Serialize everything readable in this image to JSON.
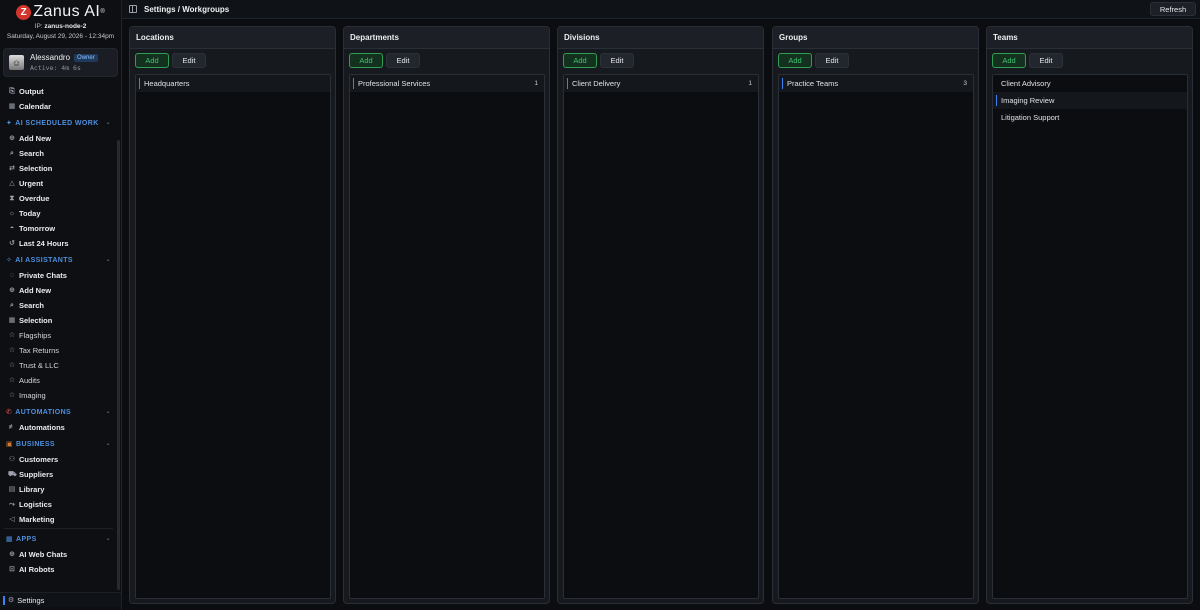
{
  "brand": {
    "logo_letter": "Z",
    "name": "Zanus AI",
    "reg": "®"
  },
  "node": {
    "label": "IP:",
    "value": "zanus-node-2"
  },
  "datetime": "Saturday, August 29, 2026 - 12:34pm",
  "user": {
    "name": "Alessandro",
    "role": "Owner",
    "active": "Active: 4m 6s"
  },
  "nav": {
    "output": "Output",
    "calendar": "Calendar",
    "scheduled": {
      "title": "AI SCHEDULED WORK",
      "items": [
        "Add New",
        "Search",
        "Selection",
        "Urgent",
        "Overdue",
        "Today",
        "Tomorrow",
        "Last 24 Hours"
      ]
    },
    "assistants": {
      "title": "AI ASSISTANTS",
      "items": [
        "Private Chats",
        "Add New",
        "Search",
        "Selection"
      ],
      "sub_items": [
        "Flagships",
        "Tax Returns",
        "Trust & LLC",
        "Audits",
        "Imaging"
      ]
    },
    "automations": {
      "title": "AUTOMATIONS",
      "items": [
        "Automations"
      ]
    },
    "business": {
      "title": "BUSINESS",
      "items": [
        "Customers",
        "Suppliers",
        "Library",
        "Logistics",
        "Marketing"
      ]
    },
    "apps": {
      "title": "APPS",
      "items": [
        "AI Web Chats",
        "AI Robots"
      ]
    },
    "settings": "Settings"
  },
  "topbar": {
    "breadcrumb": "Settings / Workgroups",
    "refresh": "Refresh"
  },
  "buttons": {
    "add": "Add",
    "edit": "Edit"
  },
  "columns": [
    {
      "title": "Locations",
      "rows": [
        {
          "label": "Headquarters",
          "count": ""
        }
      ]
    },
    {
      "title": "Departments",
      "rows": [
        {
          "label": "Professional Services",
          "count": "1"
        }
      ]
    },
    {
      "title": "Divisions",
      "rows": [
        {
          "label": "Client Delivery",
          "count": "1"
        }
      ]
    },
    {
      "title": "Groups",
      "rows": [
        {
          "label": "Practice Teams",
          "count": "3"
        }
      ]
    },
    {
      "title": "Teams",
      "rows": [
        {
          "label": "Client Advisory",
          "count": ""
        },
        {
          "label": "Imaging Review",
          "count": ""
        },
        {
          "label": "Litigation Support",
          "count": ""
        }
      ]
    }
  ],
  "colors": {
    "accent": "#3b82f6",
    "add_green": "#3ec46d",
    "section_blue": "#4e8fe0",
    "brand_red": "#d2352c"
  }
}
